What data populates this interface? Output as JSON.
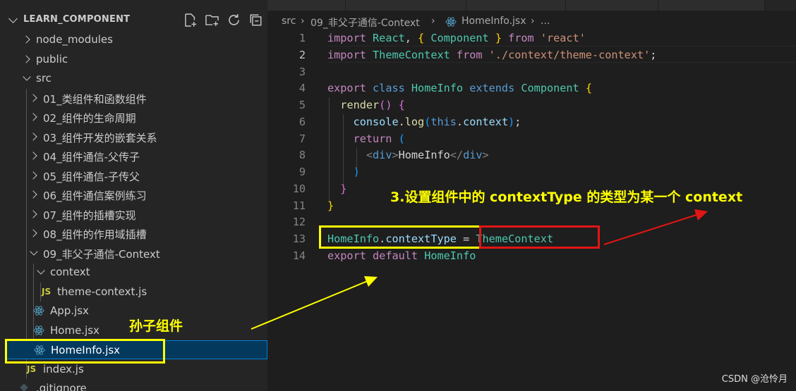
{
  "explorer": {
    "title": "LEARN_COMPONENT",
    "tree": [
      {
        "label": "node_modules",
        "kind": "folder"
      },
      {
        "label": "public",
        "kind": "folder"
      },
      {
        "label": "src",
        "kind": "folder-open"
      },
      {
        "label": "01_类组件和函数组件",
        "kind": "folder"
      },
      {
        "label": "02_组件的生命周期",
        "kind": "folder"
      },
      {
        "label": "03_组件开发的嵌套关系",
        "kind": "folder"
      },
      {
        "label": "04_组件通信-父传子",
        "kind": "folder"
      },
      {
        "label": "05_组件通信-子传父",
        "kind": "folder"
      },
      {
        "label": "06_组件通信案例练习",
        "kind": "folder"
      },
      {
        "label": "07_组件的插槽实现",
        "kind": "folder"
      },
      {
        "label": "08_组件的作用域插槽",
        "kind": "folder"
      },
      {
        "label": "09_非父子通信-Context",
        "kind": "folder-open"
      },
      {
        "label": "context",
        "kind": "folder-open"
      },
      {
        "label": "theme-context.js",
        "kind": "js-file",
        "icon": "JS"
      },
      {
        "label": "App.jsx",
        "kind": "react-file"
      },
      {
        "label": "Home.jsx",
        "kind": "react-file"
      },
      {
        "label": "HomeInfo.jsx",
        "kind": "react-file",
        "selected": true
      },
      {
        "label": "index.js",
        "kind": "js-file",
        "icon": "JS"
      },
      {
        "label": ".gitignore",
        "kind": "file"
      }
    ]
  },
  "breadcrumb": {
    "seg1": "src",
    "seg2": "09_非父子通信-Context",
    "seg3": "HomeInfo.jsx",
    "seg4": "..."
  },
  "editor": {
    "active_line": 2,
    "line_numbers": [
      "1",
      "2",
      "3",
      "4",
      "5",
      "6",
      "7",
      "8",
      "9",
      "10",
      "11",
      "12",
      "13",
      "14"
    ]
  },
  "annotations": {
    "note_context_type": "3.设置组件中的 contextType 的类型为某一个 context",
    "note_grandchild": "孙子组件"
  },
  "colors": {
    "annotation_yellow": "#ffff00",
    "annotation_red": "#e21515",
    "selection_blue": "#04395e"
  },
  "watermark": "CSDN @沧怜月"
}
